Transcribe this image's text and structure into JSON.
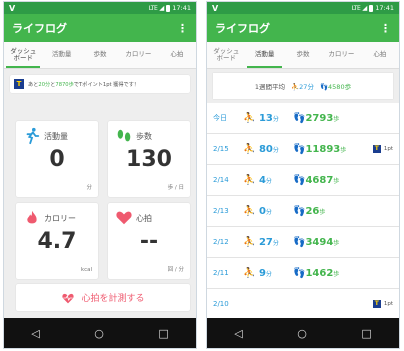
{
  "status": {
    "network": "LTE",
    "time": "17:41"
  },
  "app": {
    "title": "ライフログ",
    "menu": "⋮"
  },
  "tabs": [
    {
      "label": "ダッシュ\nボード"
    },
    {
      "label": "活動量"
    },
    {
      "label": "歩数"
    },
    {
      "label": "カロリー"
    },
    {
      "label": "心拍"
    }
  ],
  "dashboard": {
    "tpoint": {
      "pre": "あと",
      "min": "20分",
      "mid": "と",
      "steps": "7870歩",
      "post": "でTポイント1pt 獲得です！"
    },
    "cards": {
      "activity": {
        "label": "活動量",
        "value": "0",
        "unit": "分"
      },
      "steps": {
        "label": "歩数",
        "value": "130",
        "unit": "歩 / 日"
      },
      "calorie": {
        "label": "カロリー",
        "value": "4.7",
        "unit": "kcal"
      },
      "heart": {
        "label": "心拍",
        "value": "--",
        "unit": "回 / 分"
      }
    },
    "heart_button": "心拍を計測する"
  },
  "activity_page": {
    "weekly_avg": {
      "label": "1週間平均",
      "activity": "27",
      "activity_unit": "分",
      "steps": "4580",
      "steps_unit": "歩"
    },
    "rows": [
      {
        "date": "今日",
        "activity": "13",
        "steps": "2793",
        "tpoint": ""
      },
      {
        "date": "2/15",
        "activity": "80",
        "steps": "11893",
        "tpoint": "1pt"
      },
      {
        "date": "2/14",
        "activity": "4",
        "steps": "4687",
        "tpoint": ""
      },
      {
        "date": "2/13",
        "activity": "0",
        "steps": "26",
        "tpoint": ""
      },
      {
        "date": "2/12",
        "activity": "27",
        "steps": "3494",
        "tpoint": ""
      },
      {
        "date": "2/11",
        "activity": "9",
        "steps": "1462",
        "tpoint": ""
      },
      {
        "date": "2/10",
        "activity": "",
        "steps": "",
        "tpoint": "1pt"
      }
    ],
    "units": {
      "activity": "分",
      "steps": "歩"
    }
  },
  "nav": {
    "back": "◁",
    "home": "○",
    "recent": "□"
  },
  "colors": {
    "green": "#43b54d",
    "blue": "#2b9bd8",
    "pink": "#ef5a6f"
  }
}
